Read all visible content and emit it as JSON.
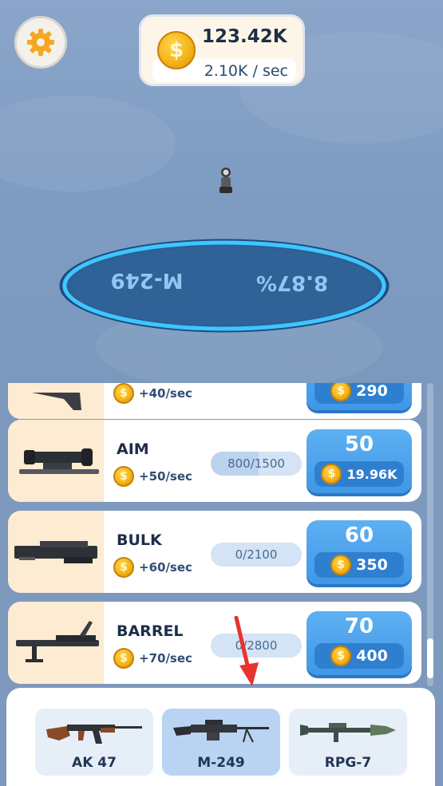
{
  "currency": {
    "amount": "123.42K",
    "rate": "2.10K / sec",
    "icon": "dollar-coin-icon"
  },
  "settings": {
    "icon": "gear-icon"
  },
  "platform": {
    "weapon_label": "M-249",
    "percent_label": "8.87%",
    "glow_color": "#3fc6ff"
  },
  "items": [
    {
      "name": "",
      "rate": "+40/sec",
      "progress": "",
      "progress_fraction": 0,
      "level": "",
      "price": "290"
    },
    {
      "name": "AIM",
      "rate": "+50/sec",
      "progress": "800/1500",
      "progress_fraction": 0.53,
      "level": "50",
      "price": "19.96K"
    },
    {
      "name": "BULK",
      "rate": "+60/sec",
      "progress": "0/2100",
      "progress_fraction": 0,
      "level": "60",
      "price": "350"
    },
    {
      "name": "BARREL",
      "rate": "+70/sec",
      "progress": "0/2800",
      "progress_fraction": 0,
      "level": "70",
      "price": "400"
    }
  ],
  "weapons": [
    {
      "label": "AK 47",
      "selected": false
    },
    {
      "label": "M-249",
      "selected": true
    },
    {
      "label": "RPG-7",
      "selected": false
    }
  ],
  "coin_symbol": "$",
  "colors": {
    "buy_button": "#4aa3ec",
    "card_thumb": "#fdebd2",
    "accent_arrow": "#e8322e"
  }
}
